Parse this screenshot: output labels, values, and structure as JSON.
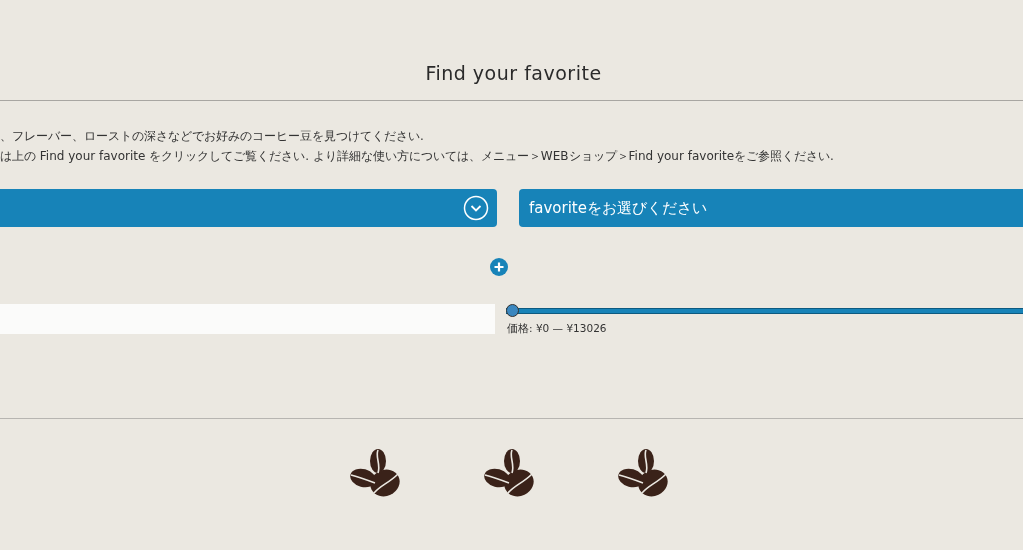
{
  "title": "Find your favorite",
  "description": [
    "、フレーバー、ローストの深さなどでお好みのコーヒー豆を見つけてください.",
    "は上の Find your favorite をクリックしてご覧ください. より詳細な使い方については、メニュー＞WEBショップ＞Find your favoriteをご参照ください."
  ],
  "selects": [
    {
      "kind": "icon"
    },
    {
      "kind": "text",
      "value": "favoriteをお選びください"
    }
  ],
  "price_slider": {
    "level": 0,
    "label": "価格: ¥0 — ¥13026"
  }
}
